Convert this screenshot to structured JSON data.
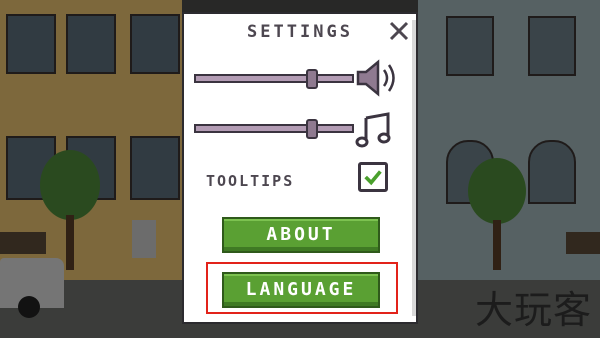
{
  "settings": {
    "title": "SETTINGS",
    "music_volume": 0.74,
    "sfx_volume": 0.74,
    "tooltips_label": "TOOLTIPS",
    "tooltips_checked": true,
    "about_label": "ABOUT",
    "language_label": "LANGUAGE"
  },
  "watermark": "大玩客",
  "icons": {
    "close": "close-icon",
    "speaker": "speaker-icon",
    "music": "music-note-icon",
    "check": "checkmark-icon"
  },
  "colors": {
    "button_green": "#5aa033",
    "highlight_red": "#e2231a",
    "slider_fill": "#b39cb4"
  }
}
